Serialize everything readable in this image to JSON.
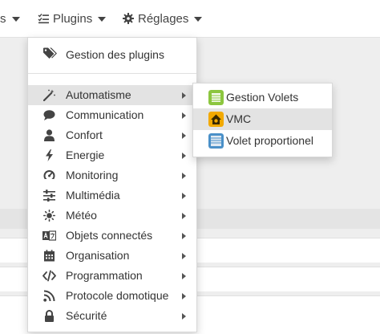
{
  "navbar": {
    "partial_label": "s",
    "plugins_label": "Plugins",
    "settings_label": "Réglages"
  },
  "dropdown": {
    "header_label": "Gestion des plugins",
    "items": [
      {
        "label": "Automatisme",
        "icon": "magic-wand-icon"
      },
      {
        "label": "Communication",
        "icon": "speech-bubble-icon"
      },
      {
        "label": "Confort",
        "icon": "user-icon"
      },
      {
        "label": "Energie",
        "icon": "lightning-bolt-icon"
      },
      {
        "label": "Monitoring",
        "icon": "dashboard-icon"
      },
      {
        "label": "Multimédia",
        "icon": "sliders-icon"
      },
      {
        "label": "Météo",
        "icon": "sun-icon"
      },
      {
        "label": "Objets connectés",
        "icon": "language-icon"
      },
      {
        "label": "Organisation",
        "icon": "calendar-icon"
      },
      {
        "label": "Programmation",
        "icon": "code-icon"
      },
      {
        "label": "Protocole domotique",
        "icon": "rss-icon"
      },
      {
        "label": "Sécurité",
        "icon": "lock-icon"
      }
    ]
  },
  "submenu": {
    "items": [
      {
        "label": "Gestion Volets",
        "icon": "shutter-plugin-icon"
      },
      {
        "label": "VMC",
        "icon": "vmc-plugin-icon"
      },
      {
        "label": "Volet proportionel",
        "icon": "proportional-shutter-plugin-icon"
      }
    ]
  },
  "colors": {
    "hover_bg": "#e3e3e3",
    "plugin_green": "#8cc63f",
    "plugin_orange": "#f2a900",
    "plugin_blue": "#4a90c8"
  }
}
